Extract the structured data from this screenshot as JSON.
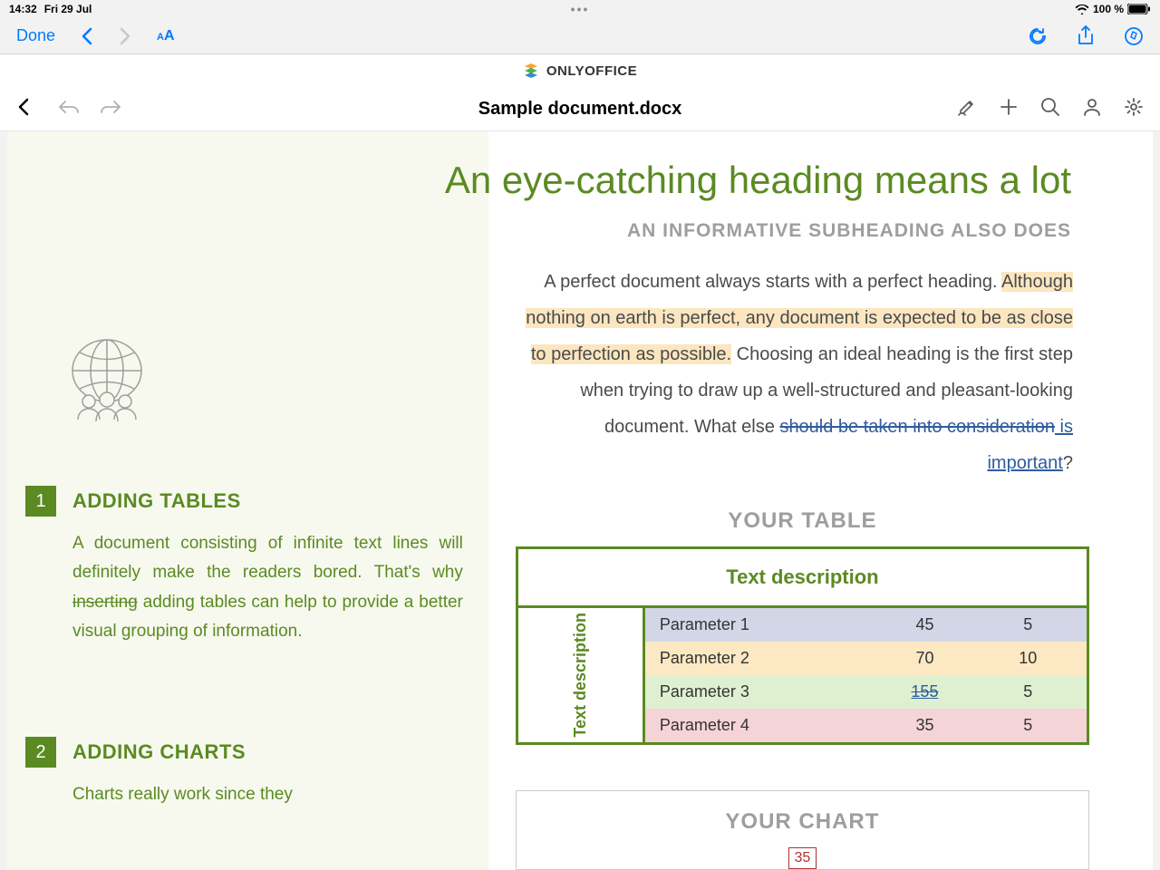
{
  "status": {
    "time": "14:32",
    "date": "Fri 29 Jul",
    "battery": "100 %"
  },
  "browser": {
    "done": "Done"
  },
  "app": {
    "brand": "ONLYOFFICE",
    "filename": "Sample document.docx"
  },
  "doc": {
    "h1": "An eye-catching heading means a lot",
    "h2": "AN INFORMATIVE SUBHEADING ALSO DOES",
    "para_pre": "A perfect document always starts with a perfect heading. ",
    "para_hl": "Although nothing on earth is perfect, any document is expected to be as close to perfection as possible.",
    "para_mid": " Choosing an ideal heading is the first step when trying to draw up a well-structured and pleasant-looking document. What else ",
    "para_strike": "should be taken into consideration",
    "para_insert": " is important",
    "para_end": "?",
    "table_title": "YOUR TABLE",
    "table_header": "Text description",
    "table_side": "Text description",
    "rows": [
      {
        "p": "Parameter 1",
        "v1": "45",
        "v2": "5"
      },
      {
        "p": "Parameter 2",
        "v1": "70",
        "v2": "10"
      },
      {
        "p": "Parameter 3",
        "v1": "155",
        "v2": "5"
      },
      {
        "p": "Parameter 4",
        "v1": "35",
        "v2": "5"
      }
    ],
    "chart_title": "YOUR CHART",
    "chart_frag1": "35",
    "sections": [
      {
        "num": "1",
        "title": "ADDING TABLES",
        "body_pre": "A document consisting of infinite text lines will definitely make the readers bored. That's why ",
        "body_strike": "inserting",
        "body_post": " adding tables can help to provide a better visual grouping of information."
      },
      {
        "num": "2",
        "title": "ADDING CHARTS",
        "body_pre": "Charts really work since they",
        "body_strike": "",
        "body_post": ""
      }
    ]
  }
}
